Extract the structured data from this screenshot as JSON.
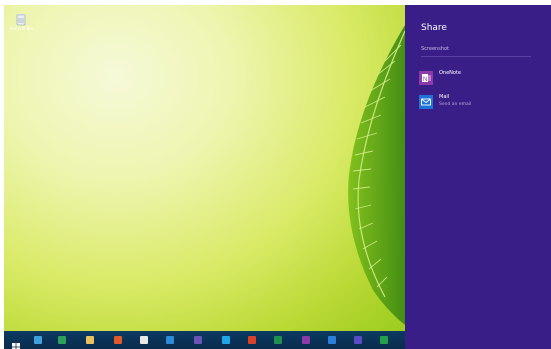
{
  "desktop": {
    "icons": [
      {
        "label": "Recycle Bin",
        "icon": "recycle-bin-icon"
      }
    ]
  },
  "taskbar": {
    "items": [
      {
        "name": "start-button",
        "icon": "windows-logo-icon",
        "color": "#ffffff"
      },
      {
        "name": "internet-explorer-button",
        "icon": "internet-explorer-icon",
        "color": "#3fa0e0"
      },
      {
        "name": "store-button",
        "icon": "store-icon",
        "color": "#2aa05a"
      },
      {
        "name": "file-explorer-button",
        "icon": "folder-icon",
        "color": "#e8c060"
      },
      {
        "name": "office-button",
        "icon": "office-icon",
        "color": "#e2582b"
      },
      {
        "name": "document-button",
        "icon": "document-icon",
        "color": "#e8e8e8"
      },
      {
        "name": "remote-desktop-button",
        "icon": "remote-desktop-icon",
        "color": "#2b8bd6"
      },
      {
        "name": "filter-app-button",
        "icon": "filter-icon",
        "color": "#6a52b8"
      },
      {
        "name": "skype-button",
        "icon": "skype-icon",
        "color": "#1fa6e8"
      },
      {
        "name": "powerpoint-button",
        "icon": "powerpoint-icon",
        "color": "#d9412b"
      },
      {
        "name": "excel-button",
        "icon": "excel-icon",
        "color": "#1f8f4e"
      },
      {
        "name": "onenote-button",
        "icon": "onenote-icon",
        "color": "#8b3aa8"
      },
      {
        "name": "onedrive-button",
        "icon": "onedrive-icon",
        "color": "#2b7fd9"
      },
      {
        "name": "settings-app-button",
        "icon": "gear-icon",
        "color": "#5a4bc4"
      },
      {
        "name": "chart-app-button",
        "icon": "chart-icon",
        "color": "#22a04b"
      }
    ]
  },
  "share": {
    "title": "Share",
    "subtitle": "Screenshot",
    "accent": "#3a1e88",
    "apps": [
      {
        "name": "OneNote",
        "description": "",
        "icon": "onenote-icon",
        "color": "#8b3aa8"
      },
      {
        "name": "Mail",
        "description": "Send an email",
        "icon": "mail-icon",
        "color": "#1f73d6"
      }
    ]
  }
}
